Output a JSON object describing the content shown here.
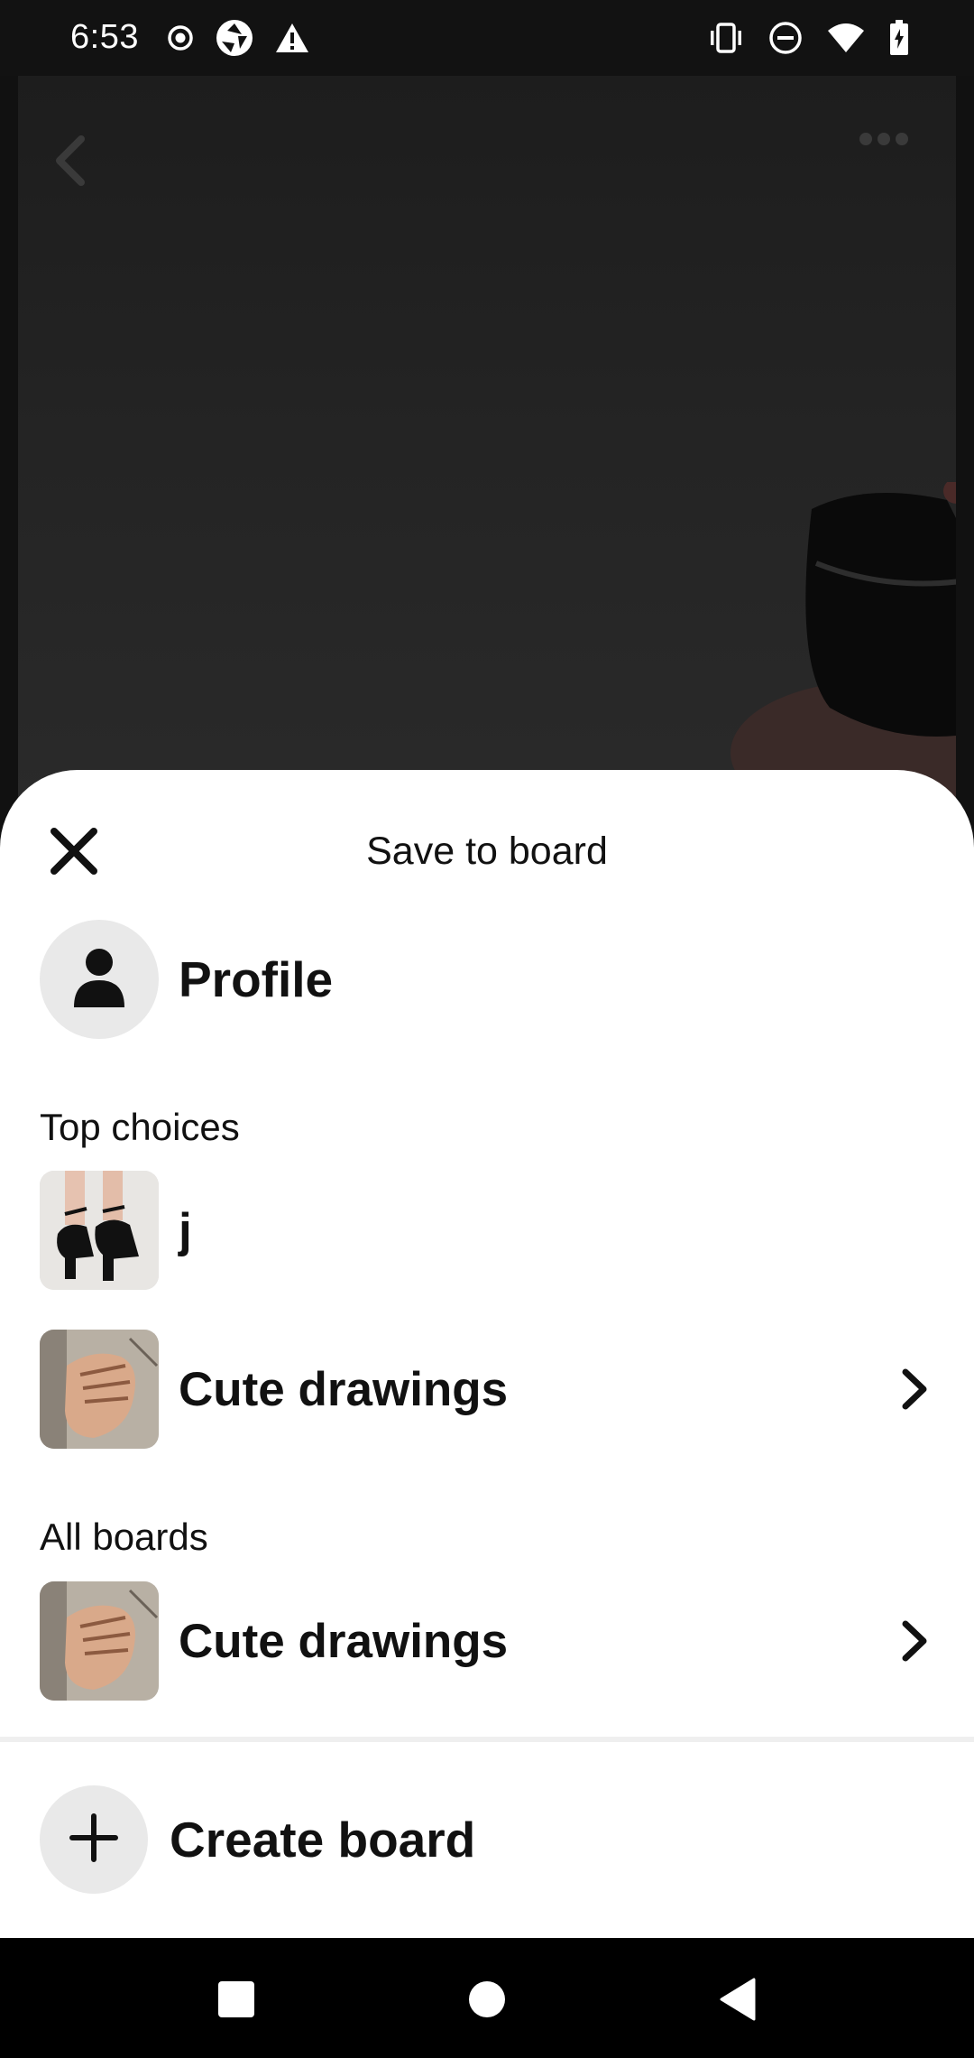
{
  "status_bar": {
    "time": "6:53",
    "left_icons": [
      "record-icon",
      "aperture-icon",
      "warning-icon"
    ],
    "right_icons": [
      "vibrate-icon",
      "do-not-disturb-icon",
      "wifi-icon",
      "battery-charging-icon"
    ]
  },
  "background_pin": {
    "icons": [
      "back-chevron-icon",
      "more-options-icon"
    ]
  },
  "sheet": {
    "title": "Save to board",
    "close_icon": "close-icon",
    "profile": {
      "label": "Profile",
      "icon": "person-icon"
    },
    "sections": {
      "top_choices_label": "Top choices",
      "all_boards_label": "All boards"
    },
    "top_choices": [
      {
        "name": "j",
        "thumbnail": "black-heels-image",
        "has_chevron": false
      },
      {
        "name": "Cute drawings",
        "thumbnail": "hand-drawing-image",
        "has_chevron": true
      }
    ],
    "all_boards": [
      {
        "name": "Cute drawings",
        "thumbnail": "hand-drawing-image",
        "has_chevron": true
      }
    ],
    "create_board": {
      "label": "Create board",
      "icon": "plus-icon"
    }
  },
  "nav_bar": {
    "buttons": [
      "recents-square-icon",
      "home-circle-icon",
      "back-triangle-icon"
    ]
  },
  "colors": {
    "sheet_background": "#ffffff",
    "text": "#111111",
    "avatar_background": "#e9e9e9",
    "overlay_background": "#1f1f1f"
  }
}
